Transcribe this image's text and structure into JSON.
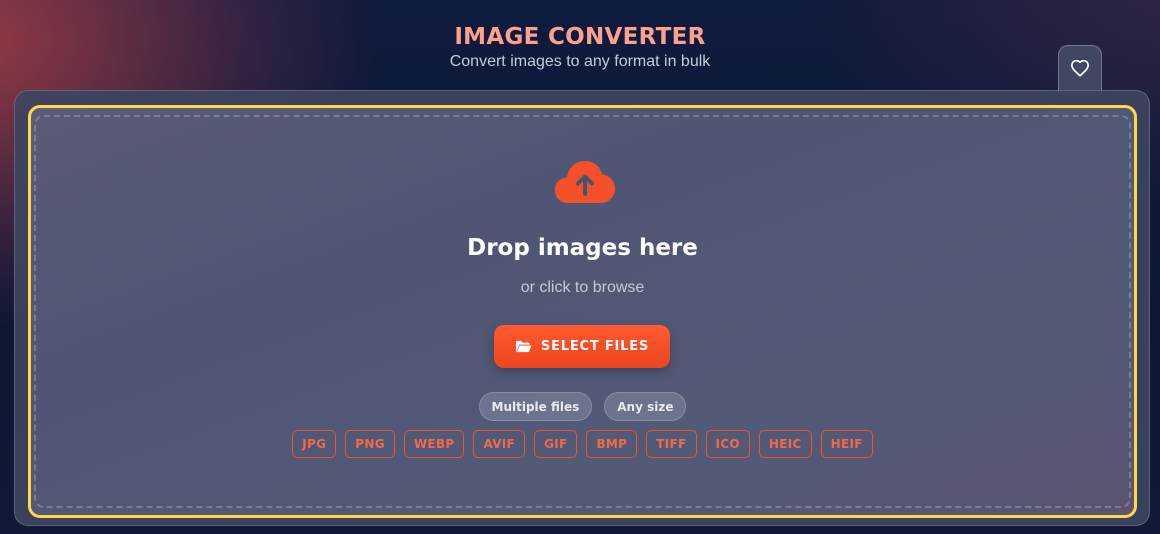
{
  "header": {
    "title": "IMAGE CONVERTER",
    "subtitle": "Convert images to any format in bulk"
  },
  "favorite_button": {
    "icon": "heart-icon"
  },
  "dropzone": {
    "icon": "cloud-upload-icon",
    "title": "Drop images here",
    "subtitle": "or click to browse",
    "select_button": {
      "label": "SELECT FILES",
      "icon": "folder-open-icon"
    },
    "badges": [
      "Multiple files",
      "Any size"
    ],
    "formats": [
      "JPG",
      "PNG",
      "WEBP",
      "AVIF",
      "GIF",
      "BMP",
      "TIFF",
      "ICO",
      "HEIC",
      "HEIF"
    ]
  },
  "colors": {
    "accent": "#ff5a30",
    "dropzone_border": "#ffd84a",
    "title": "#ffa08c"
  }
}
